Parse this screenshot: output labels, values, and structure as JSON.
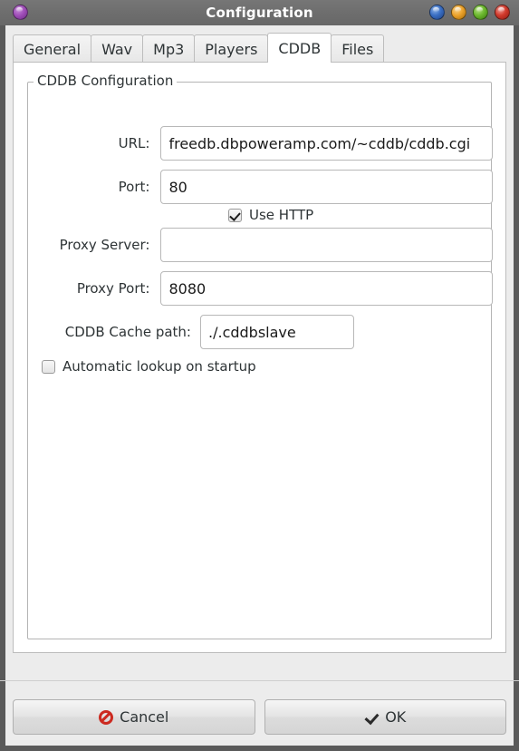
{
  "window": {
    "title": "Configuration",
    "menu_icon": "app-menu-orb",
    "controls": [
      {
        "name": "shade-button",
        "color": "#3a6fc4"
      },
      {
        "name": "minimize-button",
        "color": "#eda32c"
      },
      {
        "name": "maximize-button",
        "color": "#6db92f"
      },
      {
        "name": "close-button",
        "color": "#d23a2c"
      }
    ]
  },
  "tabs": [
    {
      "label": "General",
      "active": false
    },
    {
      "label": "Wav",
      "active": false
    },
    {
      "label": "Mp3",
      "active": false
    },
    {
      "label": "Players",
      "active": false
    },
    {
      "label": "CDDB",
      "active": true
    },
    {
      "label": "Files",
      "active": false
    }
  ],
  "group": {
    "title": "CDDB Configuration"
  },
  "fields": {
    "url": {
      "label": "URL:",
      "value": "freedb.dbpoweramp.com/~cddb/cddb.cgi",
      "placeholder": ""
    },
    "port": {
      "label": "Port:",
      "value": "80",
      "placeholder": ""
    },
    "proxy_server": {
      "label": "Proxy Server:",
      "value": "",
      "placeholder": ""
    },
    "proxy_port": {
      "label": "Proxy Port:",
      "value": "8080",
      "placeholder": ""
    },
    "cache_path": {
      "label": "CDDB Cache path:",
      "value": "./.cddbslave",
      "placeholder": ""
    }
  },
  "checkboxes": {
    "use_http": {
      "label": "Use HTTP",
      "checked": true
    },
    "auto_lookup": {
      "label": "Automatic lookup on startup",
      "checked": false
    }
  },
  "buttons": {
    "cancel": {
      "label": "Cancel",
      "icon": "cancel-icon"
    },
    "ok": {
      "label": "OK",
      "icon": "check-icon"
    }
  }
}
